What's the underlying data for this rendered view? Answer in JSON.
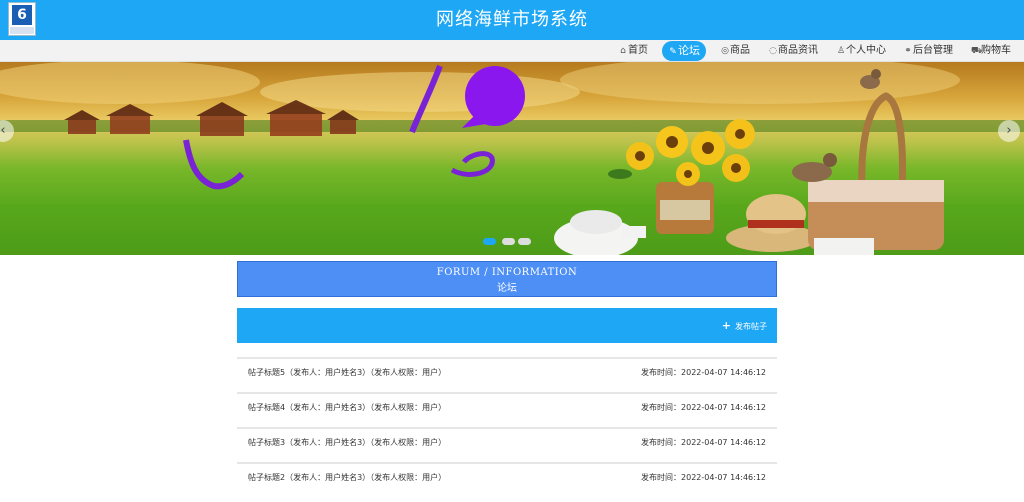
{
  "site": {
    "title": "网络海鲜市场系统"
  },
  "nav": [
    {
      "label": "首页",
      "icon": "home-icon",
      "glyph": "⌂"
    },
    {
      "label": "论坛",
      "icon": "chat-icon",
      "glyph": "✎",
      "active": true
    },
    {
      "label": "商品",
      "icon": "goods-icon",
      "glyph": "◎"
    },
    {
      "label": "商品资讯",
      "icon": "news-icon",
      "glyph": "◌"
    },
    {
      "label": "个人中心",
      "icon": "user-icon",
      "glyph": "♙"
    },
    {
      "label": "后台管理",
      "icon": "link-icon",
      "glyph": "⚭"
    },
    {
      "label": "购物车",
      "icon": "cart-icon",
      "glyph": "⛟"
    }
  ],
  "carousel": {
    "prev": "‹",
    "next": "›",
    "slides": 3,
    "active_slide": 1
  },
  "forum": {
    "heading_en": "FORUM / INFORMATION",
    "heading_zh": "论坛",
    "post_button": "发布帖子",
    "posts": [
      {
        "title": "帖子标题5（发布人：用户姓名3）（发布人权限：用户）",
        "time": "发布时间：2022-04-07 14:46:12"
      },
      {
        "title": "帖子标题4（发布人：用户姓名3）（发布人权限：用户）",
        "time": "发布时间：2022-04-07 14:46:12"
      },
      {
        "title": "帖子标题3（发布人：用户姓名3）（发布人权限：用户）",
        "time": "发布时间：2022-04-07 14:46:12"
      },
      {
        "title": "帖子标题2（发布人：用户姓名3）（发布人权限：用户）",
        "time": "发布时间：2022-04-07 14:46:12"
      }
    ]
  }
}
